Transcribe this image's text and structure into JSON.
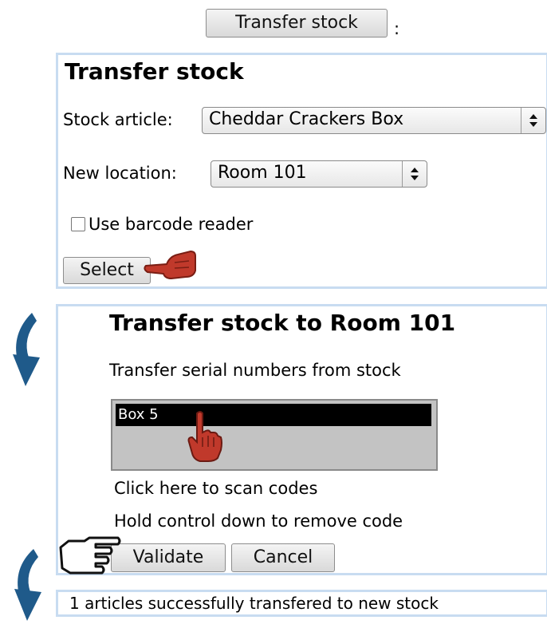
{
  "top_button": {
    "label": "Transfer stock",
    "trailing": ":"
  },
  "panel1": {
    "title": "Transfer stock",
    "stock_article_label": "Stock article:",
    "stock_article_value": "Cheddar Crackers Box",
    "new_location_label": "New location:",
    "new_location_value": "Room 101",
    "barcode_label": "Use barcode reader",
    "select_button": "Select"
  },
  "panel2": {
    "title": "Transfer stock to Room 101",
    "subtitle": "Transfer serial numbers from stock",
    "list_selected": "Box 5",
    "scan_hint": "Click here to scan codes",
    "remove_hint": "Hold control down to remove code",
    "validate_button": "Validate",
    "cancel_button": "Cancel"
  },
  "result": {
    "message": "1 articles successfully transfered to new stock"
  },
  "colors": {
    "panel_border": "#c8dcf1",
    "arrow": "#1f5a8a",
    "pointer": "#c0392b"
  }
}
